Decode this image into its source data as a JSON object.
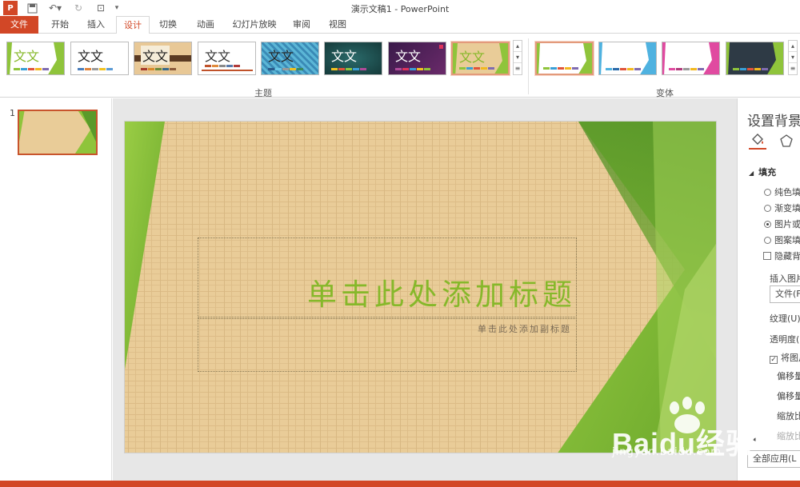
{
  "app": {
    "title": "演示文稿1 - PowerPoint"
  },
  "tabs": {
    "file": "文件",
    "home": "开始",
    "insert": "插入",
    "design": "设计",
    "transitions": "切换",
    "animations": "动画",
    "slideshow": "幻灯片放映",
    "review": "审阅",
    "view": "视图"
  },
  "ribbon": {
    "themes_group_label": "主题",
    "variants_group_label": "变体",
    "theme_sample_text": "文文",
    "theme_sample_text_2": "文文"
  },
  "slides": {
    "number": "1"
  },
  "slide": {
    "title": "单击此处添加标题",
    "subtitle": "单击此处添加副标题"
  },
  "format_pane": {
    "title": "设置背景",
    "section": "填充",
    "options": [
      "纯色填",
      "渐变填",
      "图片或",
      "图案填"
    ],
    "hide_bg": "隐藏背",
    "insert_picture": "插入图片",
    "file_button": "文件(F",
    "texture": "纹理(U)",
    "transparency": "透明度(I",
    "tile": "将图片",
    "offset_x": "偏移量",
    "offset_y": "偏移量",
    "scale_x": "缩放比",
    "scale_y": "缩放比",
    "apply_all": "全部应用(L"
  },
  "watermark": {
    "brand": "Baidu经验",
    "url": "jingyan.baidu.com"
  },
  "colors": {
    "accent": "#d24726",
    "green": "#86b82a",
    "wood": "#e9cc98"
  }
}
